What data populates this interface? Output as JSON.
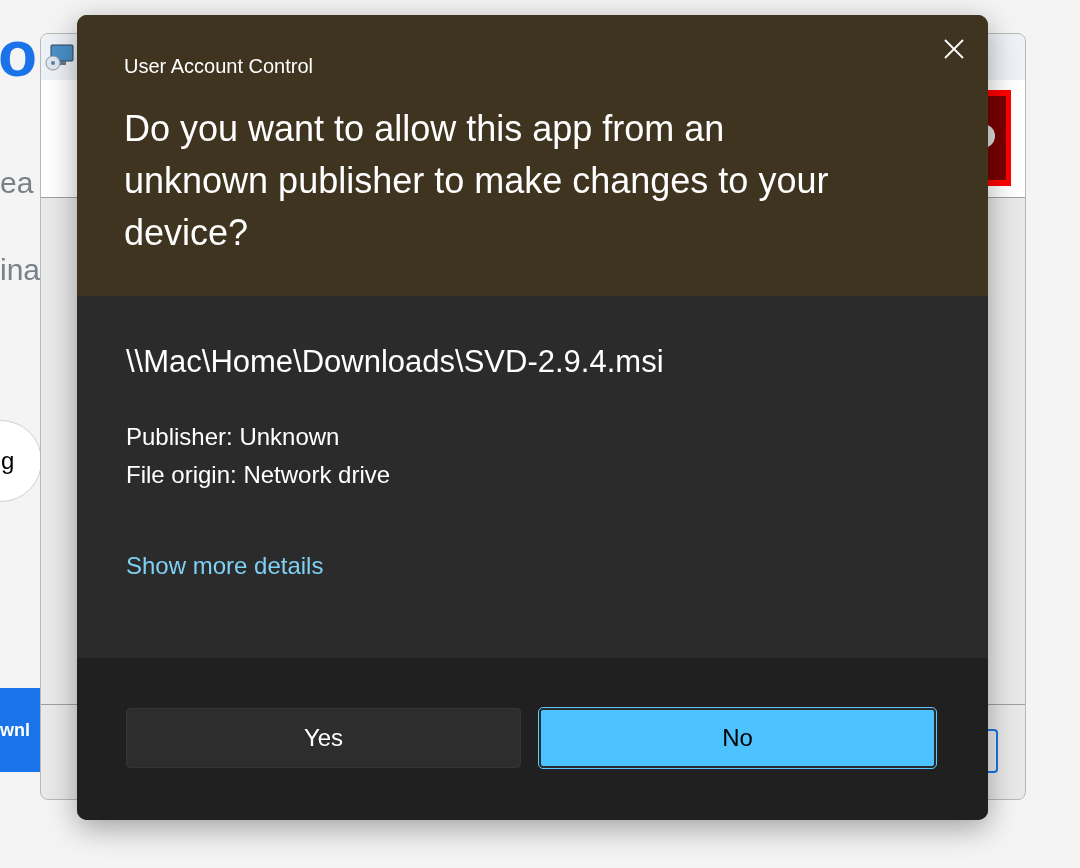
{
  "background_page": {
    "heading_fragment": "o",
    "text_fragments": [
      "ea",
      "ina"
    ],
    "pill_fragment": "g",
    "button_fragment": "wnl"
  },
  "dialog": {
    "title": "User Account Control",
    "question": "Do you want to allow this app from an unknown publisher to make changes to your device?",
    "file_path": "\\\\Mac\\Home\\Downloads\\SVD-2.9.4.msi",
    "details": [
      "Publisher: Unknown",
      "File origin: Network drive"
    ],
    "details_link": "Show more details",
    "buttons": [
      {
        "label": "Yes",
        "default": false
      },
      {
        "label": "No",
        "default": true
      }
    ]
  }
}
